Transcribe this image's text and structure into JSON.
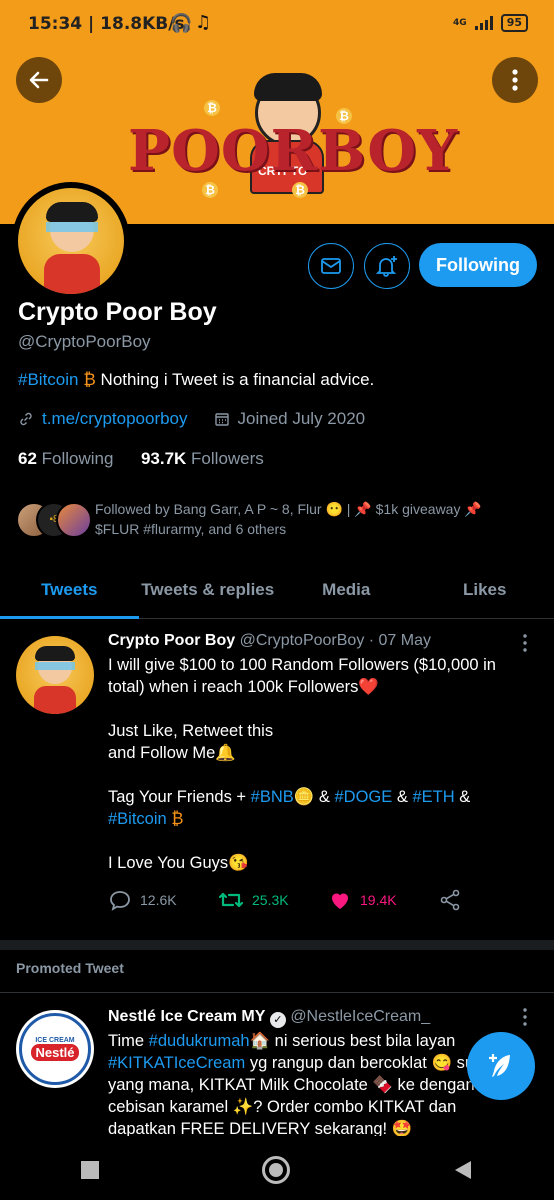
{
  "status_bar": {
    "time": "15:34 | 18.8KB/s",
    "network": "4G",
    "battery": "95"
  },
  "banner": {
    "logo_left": "POOR",
    "logo_right": "BOY",
    "logo_shirt": "CRYPTO"
  },
  "profile": {
    "name": "Crypto Poor Boy",
    "handle": "@CryptoPoorBoy",
    "bio_tag": "#Bitcoin",
    "bio_text": " Nothing i Tweet is a financial advice.",
    "link": "t.me/cryptopoorboy",
    "joined": "Joined July 2020",
    "following_count": "62",
    "following_label": "Following",
    "followers_count": "93.7K",
    "followers_label": "Followers",
    "follow_button": "Following",
    "followed_by": "Followed by Bang Garr, A P ~ 8, Flur 😶 | 📌 $1k giveaway 📌 $FLUR #flurarmy, and 6 others"
  },
  "tabs": [
    {
      "label": "Tweets",
      "active": true
    },
    {
      "label": "Tweets & replies"
    },
    {
      "label": "Media"
    },
    {
      "label": "Likes"
    }
  ],
  "tweet": {
    "author": "Crypto Poor Boy",
    "handle_date": "@CryptoPoorBoy · 07 May",
    "line1": "I will give $100 to 100 Random Followers ($10,000 in total) when i reach 100k Followers❤️",
    "line2": "Just Like, Retweet this",
    "line3": "and Follow Me🔔",
    "line4_prefix": "Tag Your Friends + ",
    "tag_bnb": "#BNB",
    "amp1": " & ",
    "tag_doge": "#DOGE",
    "amp2": " & ",
    "tag_eth": "#ETH",
    "amp3": " &",
    "tag_bitcoin": "#Bitcoin",
    "line5": "I Love You Guys😘",
    "replies": "12.6K",
    "retweets": "25.3K",
    "likes": "19.4K"
  },
  "promoted_label": "Promoted Tweet",
  "ad": {
    "author": "Nestlé Ice Cream MY",
    "handle": "@NestleIceCream_",
    "text_a": "Time ",
    "tag1": "#dudukrumah",
    "text_b": "🏠 ni serious best bila layan ",
    "tag2": "#KITKATIceCream",
    "text_c": " yg rangup dan bercoklat 😋 suka yang mana, KITKAT Milk Chocolate 🍫 ke dengan cebisan karamel ✨? Order combo KITKAT dan dapatkan FREE DELIVERY sekarang! 🤩",
    "logo_top": "ICE CREAM",
    "logo_main": "Nestlé"
  },
  "colors": {
    "accent": "#1d9bf0",
    "banner": "#f39c1a",
    "like": "#f91880",
    "retweet": "#00ba7c"
  }
}
